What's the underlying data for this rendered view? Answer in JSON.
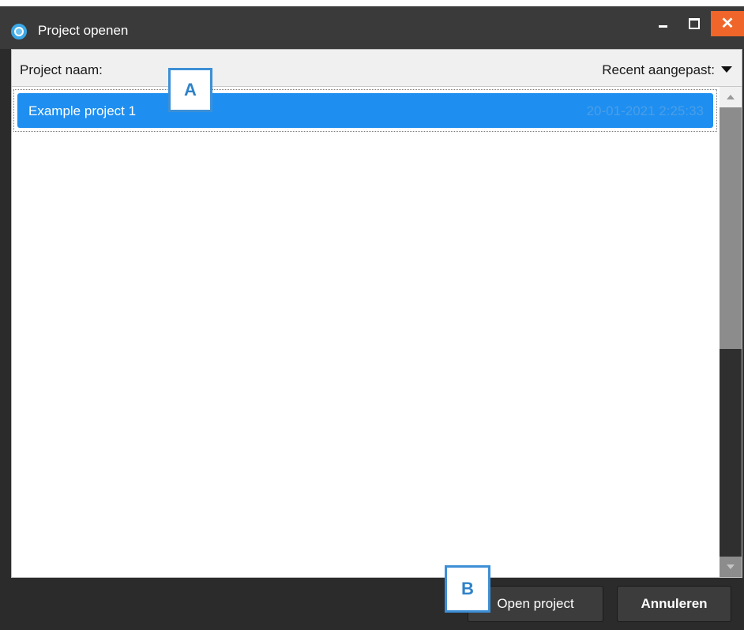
{
  "window": {
    "title": "Project openen",
    "close_glyph": "✕"
  },
  "columns": {
    "name_header": "Project naam:",
    "sort_header": "Recent aangepast:"
  },
  "projects": [
    {
      "name": "Example project 1",
      "modified": "20-01-2021 2:25:33",
      "selected": true
    }
  ],
  "footer": {
    "open_label": "Open project",
    "cancel_label": "Annuleren"
  },
  "markers": {
    "a": "A",
    "b": "B"
  },
  "colors": {
    "selection": "#1e8ff0",
    "close_button": "#f0662a",
    "marker_border": "#3d8fd6"
  }
}
